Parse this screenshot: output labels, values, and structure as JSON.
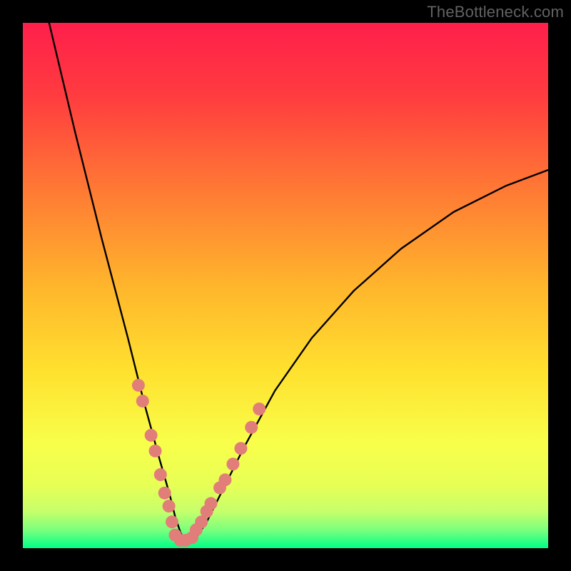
{
  "watermark": "TheBottleneck.com",
  "colors": {
    "frame": "#000000",
    "watermark": "#626262",
    "curve": "#000000",
    "dots": "#E27E7A",
    "gradient_top": "#FF1F4B",
    "gradient_mid1": "#FF7A2C",
    "gradient_mid2": "#FFE92A",
    "gradient_bottom1": "#D9FF66",
    "gradient_bottom2": "#00FF88"
  },
  "chart_data": {
    "type": "line",
    "title": "",
    "xlabel": "",
    "ylabel": "",
    "xlim": [
      0,
      100
    ],
    "ylim": [
      0,
      100
    ],
    "series": [
      {
        "name": "bottleneck-curve",
        "x": [
          5,
          10,
          15,
          20,
          23,
          26,
          28,
          29,
          30,
          31,
          32,
          33,
          35,
          38,
          42,
          48,
          55,
          63,
          72,
          82,
          92,
          100
        ],
        "values": [
          100,
          79,
          59,
          40,
          28,
          17,
          10,
          6,
          3,
          1,
          1,
          2,
          5,
          11,
          19,
          30,
          40,
          49,
          57,
          64,
          69,
          72
        ]
      }
    ],
    "scatter": [
      {
        "name": "markers-left",
        "x": [
          22.0,
          22.8,
          24.4,
          25.2,
          26.2,
          27.0,
          27.8,
          28.4
        ],
        "values": [
          31.0,
          28.0,
          21.5,
          18.5,
          14.0,
          10.5,
          8.0,
          5.0
        ]
      },
      {
        "name": "markers-bottom",
        "x": [
          29.0,
          30.0,
          31.0,
          32.2
        ],
        "values": [
          2.5,
          1.5,
          1.5,
          2.0
        ]
      },
      {
        "name": "markers-right",
        "x": [
          33.0,
          34.0,
          35.0,
          35.8,
          37.5,
          38.5,
          40.0,
          41.5,
          43.5,
          45.0
        ],
        "values": [
          3.5,
          5.0,
          7.0,
          8.5,
          11.5,
          13.0,
          16.0,
          19.0,
          23.0,
          26.5
        ]
      }
    ]
  }
}
